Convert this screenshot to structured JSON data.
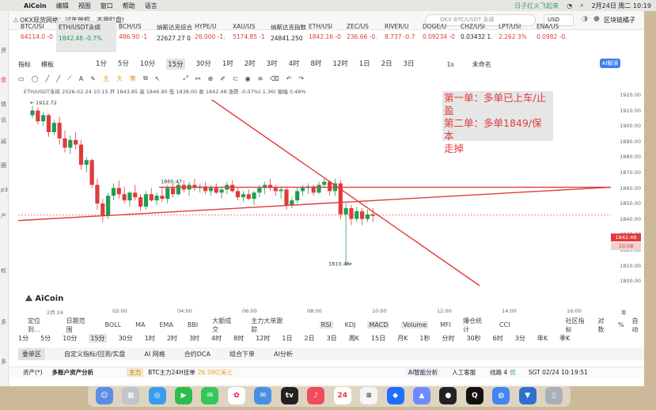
{
  "menubar": {
    "app": "AiCoin",
    "items": [
      "编辑",
      "视图",
      "窗口",
      "帮助",
      "语言"
    ],
    "ticker": "日子红火飞起来",
    "date": "2月24日 周二 10:19"
  },
  "tabstrip": {
    "tab": "OKX现货网格：过年放假，不用盯盘!",
    "search_placeholder": "OKX BTC/USDT 永续",
    "currency": "USD",
    "user": "区块链橘子"
  },
  "sidebar": [
    "资",
    "盘",
    "情",
    "讯",
    "闻",
    "圈",
    "p3",
    "产",
    "权",
    "多",
    "多"
  ],
  "tickers": [
    {
      "name": "BTC/USI",
      "value": "64114.0 -0",
      "color": "red"
    },
    {
      "name": "ETH/USDT永续",
      "value": "1842.48 -0.7%",
      "color": "green",
      "selected": true
    },
    {
      "name": "BCH/US",
      "value": "486.90 -1",
      "color": "red"
    },
    {
      "name": "纳斯达克综合",
      "value": "22627.27 0",
      "color": "dark"
    },
    {
      "name": "HYPE/U",
      "value": "26.000 -1.",
      "color": "red"
    },
    {
      "name": "XAU/US",
      "value": "5174.85 -1",
      "color": "red"
    },
    {
      "name": "纳斯达克指数",
      "value": "24841.250",
      "color": "dark"
    },
    {
      "name": "ETH/USI",
      "value": "1842.16 -0",
      "color": "red"
    },
    {
      "name": "ZEC/US",
      "value": "236.66 -0.",
      "color": "red"
    },
    {
      "name": "RIVER/U",
      "value": "8.737 -0.7",
      "color": "red"
    },
    {
      "name": "DOGE/U",
      "value": "0.09234 -0",
      "color": "red"
    },
    {
      "name": "CHZ/USI",
      "value": "0.03432 1.",
      "color": "dark"
    },
    {
      "name": "LPT/USI",
      "value": "2.262 3%",
      "color": "red"
    },
    {
      "name": "ENA/US",
      "value": "0.0982 -0.",
      "color": "red"
    }
  ],
  "toolbar": {
    "indicator": "指标",
    "template": "模板",
    "timeframes": [
      "1分",
      "5分",
      "10分",
      "15分",
      "30分",
      "1时",
      "2时",
      "3时",
      "4时",
      "8时",
      "12时",
      "1日",
      "2日",
      "3日"
    ],
    "active_tf": "15分",
    "seconds": "1s",
    "unnamed": "未命名",
    "ai_btn": "AI解读"
  },
  "drawtools": [
    "主",
    "大",
    "筹"
  ],
  "info_line": "ETH/USDT永续 2026-02-24 10:15  开 1843.85  高 1846.90  低 1838.00  收 1842.48  涨跌 -0.07%(-1.36)  振幅 0.48%",
  "annotation": {
    "line1": "第一单：多单已上车/止",
    "line2": "盈",
    "line3": "第二单：多单1849/保本",
    "line4": "走掉"
  },
  "price_labels": {
    "high": "1912.72",
    "mid": "1860.47",
    "low": "1810.46",
    "current": "1842.48",
    "countdown": "10:08"
  },
  "yaxis": [
    "1920.00",
    "1910.00",
    "1900.00",
    "1890.00",
    "1880.00",
    "1870.00",
    "1860.00",
    "1850.00",
    "1840.00",
    "1830.00",
    "1820.00",
    "1810.00",
    "1800.00"
  ],
  "xaxis": [
    "2月 24",
    "02:00",
    "04:00",
    "06:00",
    "08:00",
    "10:00",
    "12:00",
    "14:00",
    "16:00"
  ],
  "xaxis_right": "筹",
  "logo": "AiCoin",
  "indicators": {
    "left": [
      "定位到...",
      "日期范围",
      "BOLL",
      "MA",
      "EMA",
      "BBI",
      "大额成交",
      "主力大单跟踪"
    ],
    "mid": [
      "RSI",
      "KDJ",
      "MACD",
      "Volume",
      "MFI",
      "爆仓统计",
      "CCI"
    ],
    "active": [
      "RSI",
      "MACD",
      "Volume"
    ],
    "right": [
      "社区指标",
      "对数",
      "%",
      "自动"
    ]
  },
  "tf2": [
    "1分",
    "5分",
    "10分",
    "15分",
    "30分",
    "1时",
    "2时",
    "3时",
    "4时",
    "8时",
    "12时",
    "1日",
    "2日",
    "3日",
    "周K",
    "15日",
    "月K",
    "1秒",
    "分时",
    "30秒",
    "6时",
    "3分",
    "年K",
    "季K"
  ],
  "bottom_tabs": [
    "委单区",
    "自定义指标/回测/实盘",
    "AI 网格",
    "合约DCA",
    "组合下单",
    "AI分析"
  ],
  "status": {
    "assets": "资产(*)",
    "multi": "多账户资产分析",
    "main": "主力",
    "news": "BTC主力24H挂单",
    "amount": "26.59亿美元",
    "ai": "AI智能分析",
    "service": "人工客服",
    "line": "线路 4",
    "line_status": "优",
    "time": "SGT 02/24 10:19:51"
  },
  "candles": [
    [
      1907,
      1913,
      1905,
      1910
    ],
    [
      1910,
      1912,
      1901,
      1903
    ],
    [
      1903,
      1909,
      1900,
      1907
    ],
    [
      1907,
      1908,
      1893,
      1896
    ],
    [
      1896,
      1904,
      1894,
      1902
    ],
    [
      1902,
      1906,
      1888,
      1892
    ],
    [
      1892,
      1897,
      1883,
      1886
    ],
    [
      1886,
      1894,
      1882,
      1891
    ],
    [
      1891,
      1896,
      1885,
      1888
    ],
    [
      1888,
      1891,
      1872,
      1875
    ],
    [
      1875,
      1880,
      1870,
      1878
    ],
    [
      1878,
      1879,
      1860,
      1862
    ],
    [
      1862,
      1866,
      1846,
      1850
    ],
    [
      1850,
      1853,
      1838,
      1842
    ],
    [
      1842,
      1857,
      1840,
      1855
    ],
    [
      1855,
      1863,
      1852,
      1860
    ],
    [
      1860,
      1865,
      1853,
      1856
    ],
    [
      1856,
      1861,
      1850,
      1852
    ],
    [
      1852,
      1858,
      1848,
      1857
    ],
    [
      1857,
      1862,
      1852,
      1854
    ],
    [
      1854,
      1856,
      1845,
      1848
    ],
    [
      1848,
      1858,
      1846,
      1856
    ],
    [
      1856,
      1860,
      1851,
      1852
    ],
    [
      1852,
      1857,
      1849,
      1855
    ],
    [
      1855,
      1861,
      1851,
      1853
    ],
    [
      1853,
      1862,
      1850,
      1860
    ],
    [
      1860,
      1863,
      1854,
      1856
    ],
    [
      1856,
      1864,
      1855,
      1862
    ],
    [
      1862,
      1865,
      1857,
      1859
    ],
    [
      1859,
      1864,
      1855,
      1862
    ],
    [
      1862,
      1866,
      1858,
      1860
    ],
    [
      1860,
      1863,
      1857,
      1861
    ],
    [
      1861,
      1864,
      1856,
      1858
    ],
    [
      1858,
      1862,
      1855,
      1860
    ],
    [
      1860,
      1863,
      1856,
      1857
    ],
    [
      1857,
      1861,
      1853,
      1859
    ],
    [
      1859,
      1864,
      1856,
      1862
    ],
    [
      1862,
      1865,
      1857,
      1858
    ],
    [
      1858,
      1860,
      1852,
      1854
    ],
    [
      1854,
      1858,
      1851,
      1856
    ],
    [
      1856,
      1859,
      1852,
      1853
    ],
    [
      1853,
      1858,
      1849,
      1857
    ],
    [
      1857,
      1862,
      1854,
      1860
    ],
    [
      1860,
      1864,
      1856,
      1862
    ],
    [
      1862,
      1866,
      1858,
      1860
    ],
    [
      1860,
      1862,
      1855,
      1858
    ],
    [
      1858,
      1861,
      1853,
      1859
    ],
    [
      1859,
      1860,
      1846,
      1849
    ],
    [
      1849,
      1854,
      1847,
      1852
    ],
    [
      1852,
      1860,
      1850,
      1858
    ],
    [
      1858,
      1862,
      1855,
      1860
    ],
    [
      1860,
      1863,
      1856,
      1861
    ],
    [
      1861,
      1862,
      1855,
      1857
    ],
    [
      1857,
      1864,
      1856,
      1862
    ],
    [
      1862,
      1866,
      1860,
      1864
    ],
    [
      1864,
      1865,
      1855,
      1858
    ],
    [
      1858,
      1866,
      1855,
      1863
    ],
    [
      1863,
      1865,
      1840,
      1843
    ],
    [
      1843,
      1850,
      1810,
      1847
    ],
    [
      1847,
      1849,
      1836,
      1840
    ],
    [
      1840,
      1848,
      1838,
      1845
    ],
    [
      1845,
      1847,
      1836,
      1840
    ],
    [
      1840,
      1846,
      1838,
      1843
    ],
    [
      1843,
      1847,
      1838,
      1842
    ]
  ]
}
